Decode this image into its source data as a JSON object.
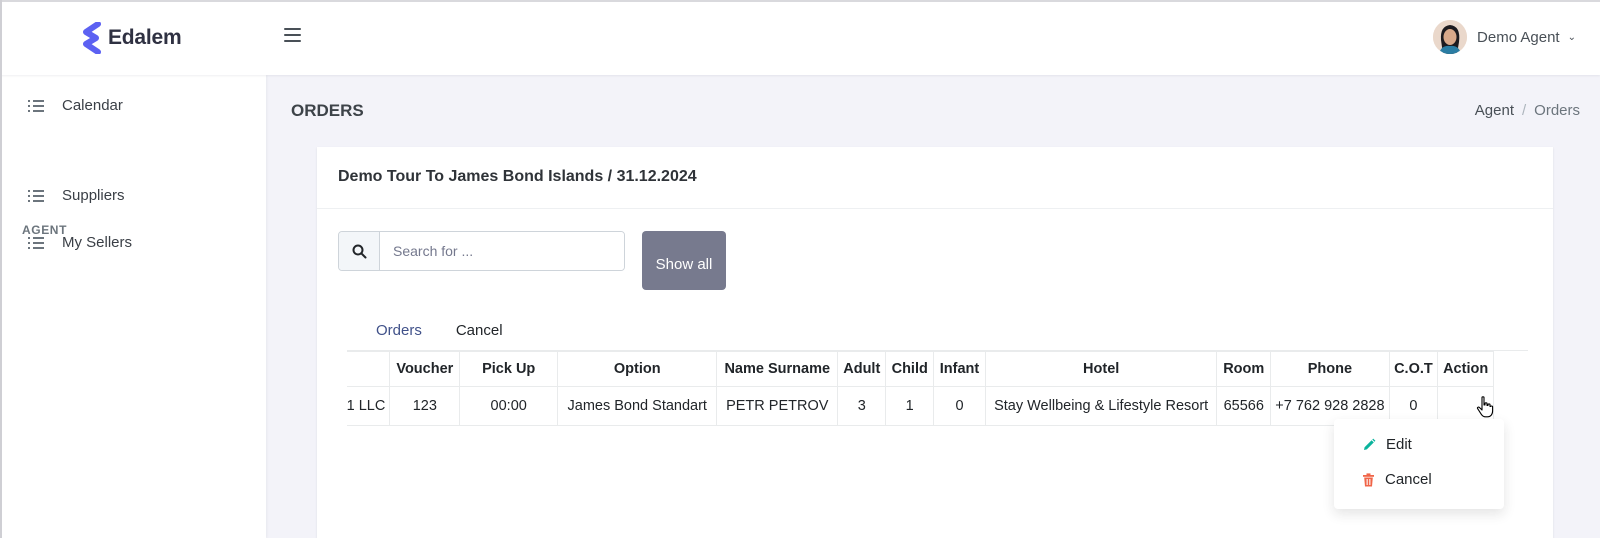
{
  "brand": {
    "name": "Edalem",
    "accent": "#5c61f2"
  },
  "header": {
    "menu_icon": "hamburger-icon",
    "user_name": "Demo Agent",
    "user_caret": "⌄"
  },
  "sidebar": {
    "items_top": [
      {
        "label": "Calendar",
        "icon": "list-icon"
      }
    ],
    "section_title": "AGENT",
    "items_agent": [
      {
        "label": "Suppliers",
        "icon": "list-icon"
      },
      {
        "label": "My Sellers",
        "icon": "list-icon"
      }
    ]
  },
  "page": {
    "title": "ORDERS",
    "breadcrumb": {
      "root": "Agent",
      "separator": "/",
      "current": "Orders"
    }
  },
  "card": {
    "title": "Demo Tour To James Bond Islands / 31.12.2024",
    "search": {
      "placeholder": "Search for ...",
      "value": "",
      "icon": "search-icon"
    },
    "show_all_label": "Show all",
    "tabs": [
      {
        "label": "Orders",
        "active": true
      },
      {
        "label": "Cancel",
        "active": false
      }
    ]
  },
  "table": {
    "columns": [
      "",
      "Voucher",
      "Pick Up",
      "Option",
      "Name Surname",
      "Adult",
      "Child",
      "Infant",
      "Hotel",
      "Room",
      "Phone",
      "C.O.T",
      "Action"
    ],
    "rows": [
      [
        "1 LLC",
        "123",
        "00:00",
        "James Bond Standart",
        "PETR PETROV",
        "3",
        "1",
        "0",
        "Stay Wellbeing & Lifestyle Resort",
        "65566",
        "+7 762 928 2828",
        "0",
        ""
      ]
    ]
  },
  "action_menu": {
    "items": [
      {
        "label": "Edit",
        "icon": "pencil-icon",
        "color": "#0ab39c"
      },
      {
        "label": "Cancel",
        "icon": "trash-icon",
        "color": "#f06548"
      }
    ]
  }
}
